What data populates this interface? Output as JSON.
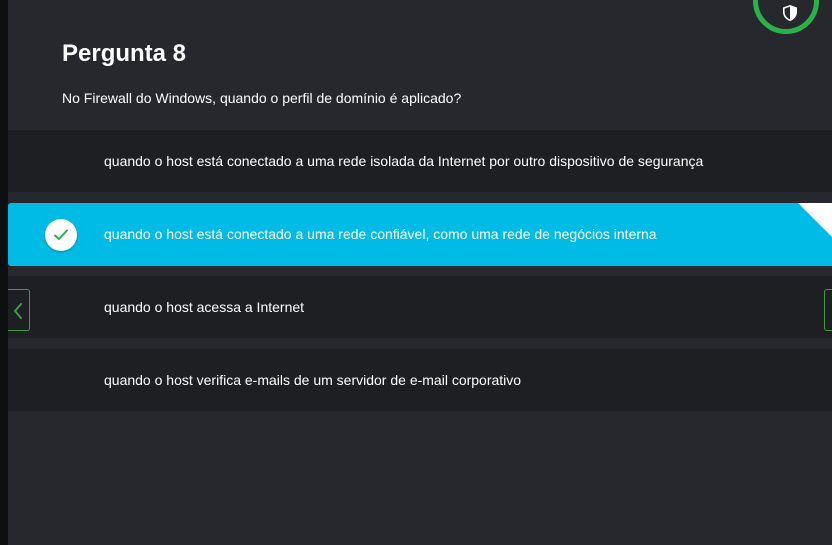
{
  "quiz": {
    "title": "Pergunta 8",
    "question": "No Firewall do Windows, quando o perfil de domínio é aplicado?",
    "options": [
      {
        "text": "quando o host está conectado a uma rede isolada da Internet por outro dispositivo de segurança",
        "selected": false
      },
      {
        "text": "quando o host está conectado a uma rede confiável, como uma rede de negócios interna",
        "selected": true
      },
      {
        "text": "quando o host acessa a Internet",
        "selected": false
      },
      {
        "text": "quando o host verifica e-mails de um servidor de e-mail corporativo",
        "selected": false
      }
    ]
  },
  "icons": {
    "check": "check-icon",
    "prev": "chevron-left-icon",
    "next": "chevron-right-icon",
    "badge": "shield-icon"
  },
  "colors": {
    "background": "#26282d",
    "option_background": "#1e1f22",
    "selected_option": "#00bbe6",
    "accent_green": "#27b34a"
  }
}
